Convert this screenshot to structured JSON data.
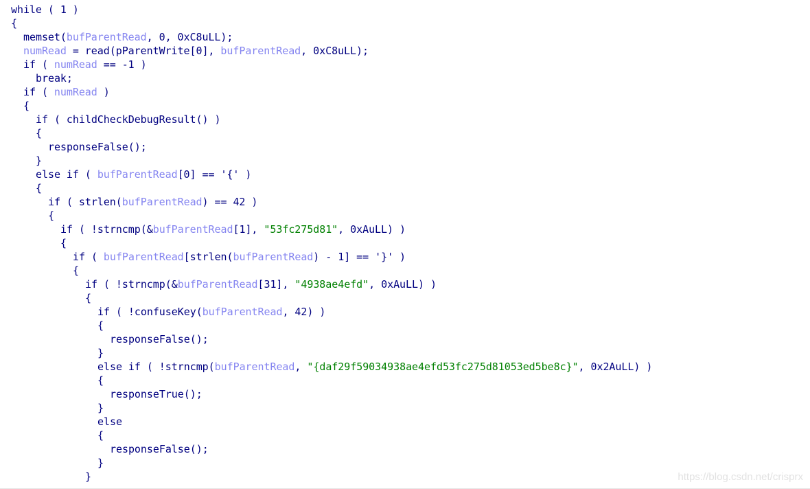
{
  "colors": {
    "keyword": "#000080",
    "variable": "#8585f0",
    "string": "#008000"
  },
  "lines": [
    {
      "indent": 0,
      "tokens": [
        [
          "n",
          "while ( 1 )"
        ]
      ]
    },
    {
      "indent": 0,
      "tokens": [
        [
          "n",
          "{"
        ]
      ]
    },
    {
      "indent": 1,
      "tokens": [
        [
          "n",
          "memset("
        ],
        [
          "v",
          "bufParentRead"
        ],
        [
          "n",
          ", 0, 0xC8uLL);"
        ]
      ]
    },
    {
      "indent": 1,
      "tokens": [
        [
          "v",
          "numRead"
        ],
        [
          "n",
          " = read(pParentWrite[0], "
        ],
        [
          "v",
          "bufParentRead"
        ],
        [
          "n",
          ", 0xC8uLL);"
        ]
      ]
    },
    {
      "indent": 1,
      "tokens": [
        [
          "n",
          "if ( "
        ],
        [
          "v",
          "numRead"
        ],
        [
          "n",
          " == -1 )"
        ]
      ]
    },
    {
      "indent": 2,
      "tokens": [
        [
          "n",
          "break;"
        ]
      ]
    },
    {
      "indent": 1,
      "tokens": [
        [
          "n",
          "if ( "
        ],
        [
          "v",
          "numRead"
        ],
        [
          "n",
          " )"
        ]
      ]
    },
    {
      "indent": 1,
      "tokens": [
        [
          "n",
          "{"
        ]
      ]
    },
    {
      "indent": 2,
      "tokens": [
        [
          "n",
          "if ( childCheckDebugResult() )"
        ]
      ]
    },
    {
      "indent": 2,
      "tokens": [
        [
          "n",
          "{"
        ]
      ]
    },
    {
      "indent": 3,
      "tokens": [
        [
          "n",
          "responseFalse();"
        ]
      ]
    },
    {
      "indent": 2,
      "tokens": [
        [
          "n",
          "}"
        ]
      ]
    },
    {
      "indent": 2,
      "tokens": [
        [
          "n",
          "else if ( "
        ],
        [
          "v",
          "bufParentRead"
        ],
        [
          "n",
          "[0] == '{' )"
        ]
      ]
    },
    {
      "indent": 2,
      "tokens": [
        [
          "n",
          "{"
        ]
      ]
    },
    {
      "indent": 3,
      "tokens": [
        [
          "n",
          "if ( strlen("
        ],
        [
          "v",
          "bufParentRead"
        ],
        [
          "n",
          ") == 42 )"
        ]
      ]
    },
    {
      "indent": 3,
      "tokens": [
        [
          "n",
          "{"
        ]
      ]
    },
    {
      "indent": 4,
      "tokens": [
        [
          "n",
          "if ( !strncmp(&"
        ],
        [
          "v",
          "bufParentRead"
        ],
        [
          "n",
          "[1], "
        ],
        [
          "s",
          "\"53fc275d81\""
        ],
        [
          "n",
          ", 0xAuLL) )"
        ]
      ]
    },
    {
      "indent": 4,
      "tokens": [
        [
          "n",
          "{"
        ]
      ]
    },
    {
      "indent": 5,
      "tokens": [
        [
          "n",
          "if ( "
        ],
        [
          "v",
          "bufParentRead"
        ],
        [
          "n",
          "[strlen("
        ],
        [
          "v",
          "bufParentRead"
        ],
        [
          "n",
          ") - 1] == '}' )"
        ]
      ]
    },
    {
      "indent": 5,
      "tokens": [
        [
          "n",
          "{"
        ]
      ]
    },
    {
      "indent": 6,
      "tokens": [
        [
          "n",
          "if ( !strncmp(&"
        ],
        [
          "v",
          "bufParentRead"
        ],
        [
          "n",
          "[31], "
        ],
        [
          "s",
          "\"4938ae4efd\""
        ],
        [
          "n",
          ", 0xAuLL) )"
        ]
      ]
    },
    {
      "indent": 6,
      "tokens": [
        [
          "n",
          "{"
        ]
      ]
    },
    {
      "indent": 7,
      "tokens": [
        [
          "n",
          "if ( !confuseKey("
        ],
        [
          "v",
          "bufParentRead"
        ],
        [
          "n",
          ", 42) )"
        ]
      ]
    },
    {
      "indent": 7,
      "tokens": [
        [
          "n",
          "{"
        ]
      ]
    },
    {
      "indent": 8,
      "tokens": [
        [
          "n",
          "responseFalse();"
        ]
      ]
    },
    {
      "indent": 7,
      "tokens": [
        [
          "n",
          "}"
        ]
      ]
    },
    {
      "indent": 7,
      "tokens": [
        [
          "n",
          "else if ( !strncmp("
        ],
        [
          "v",
          "bufParentRead"
        ],
        [
          "n",
          ", "
        ],
        [
          "s",
          "\"{daf29f59034938ae4efd53fc275d81053ed5be8c}\""
        ],
        [
          "n",
          ", 0x2AuLL) )"
        ]
      ]
    },
    {
      "indent": 7,
      "tokens": [
        [
          "n",
          "{"
        ]
      ]
    },
    {
      "indent": 8,
      "tokens": [
        [
          "n",
          "responseTrue();"
        ]
      ]
    },
    {
      "indent": 7,
      "tokens": [
        [
          "n",
          "}"
        ]
      ]
    },
    {
      "indent": 7,
      "tokens": [
        [
          "n",
          "else"
        ]
      ]
    },
    {
      "indent": 7,
      "tokens": [
        [
          "n",
          "{"
        ]
      ]
    },
    {
      "indent": 8,
      "tokens": [
        [
          "n",
          "responseFalse();"
        ]
      ]
    },
    {
      "indent": 7,
      "tokens": [
        [
          "n",
          "}"
        ]
      ]
    },
    {
      "indent": 6,
      "tokens": [
        [
          "n",
          "}"
        ]
      ]
    }
  ],
  "watermark": "https://blog.csdn.net/crisprx"
}
